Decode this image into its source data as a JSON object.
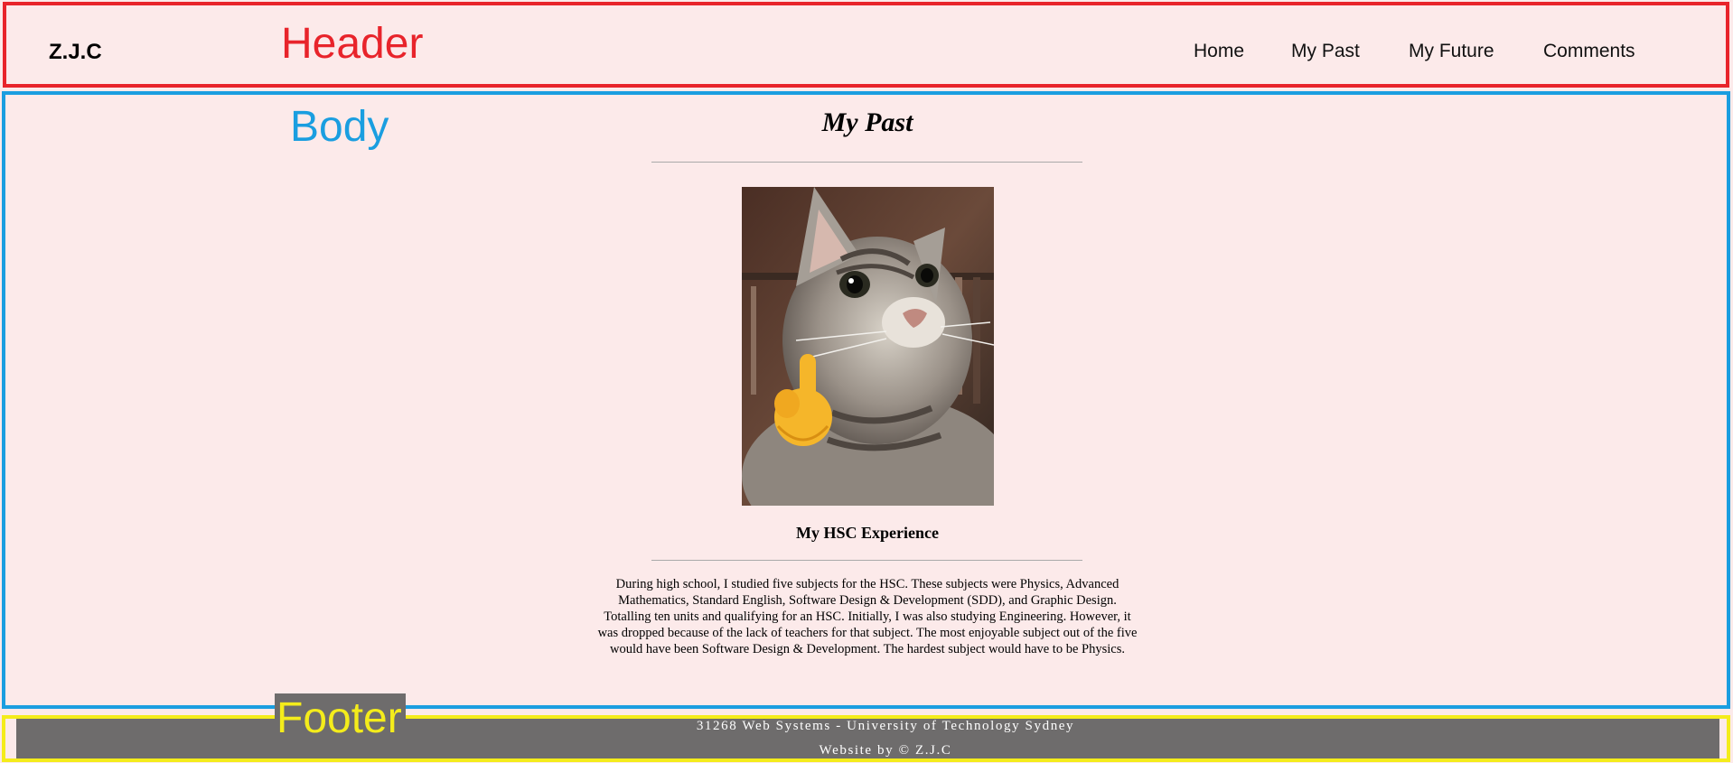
{
  "annotations": {
    "header": "Header",
    "body": "Body",
    "footer": "Footer"
  },
  "header": {
    "logo": "Z.J.C",
    "nav": [
      "Home",
      "My Past",
      "My Future",
      "Comments"
    ]
  },
  "main": {
    "title": "My Past",
    "section_heading": "My HSC Experience",
    "section_text": "During high school, I studied five subjects for the HSC. These subjects were Physics, Advanced Mathematics, Standard English, Software Design & Development (SDD), and Graphic Design. Totalling ten units and qualifying for an HSC. Initially, I was also studying Engineering. However, it was dropped because of the lack of teachers for that subject. The most enjoyable subject out of the five would have been Software Design & Development. The hardest subject would have to be Physics."
  },
  "footer": {
    "line1": "31268 Web Systems - University of Technology Sydney",
    "line2": "Website by © Z.J.C"
  },
  "colors": {
    "page_bg": "#fceaea",
    "header_frame": "#e8242b",
    "body_frame": "#1a9ee0",
    "footer_frame": "#f4ec1b",
    "footer_bg": "#6e6c6c"
  },
  "icons": {
    "photo": "cat-photo-with-hand-emoji"
  }
}
